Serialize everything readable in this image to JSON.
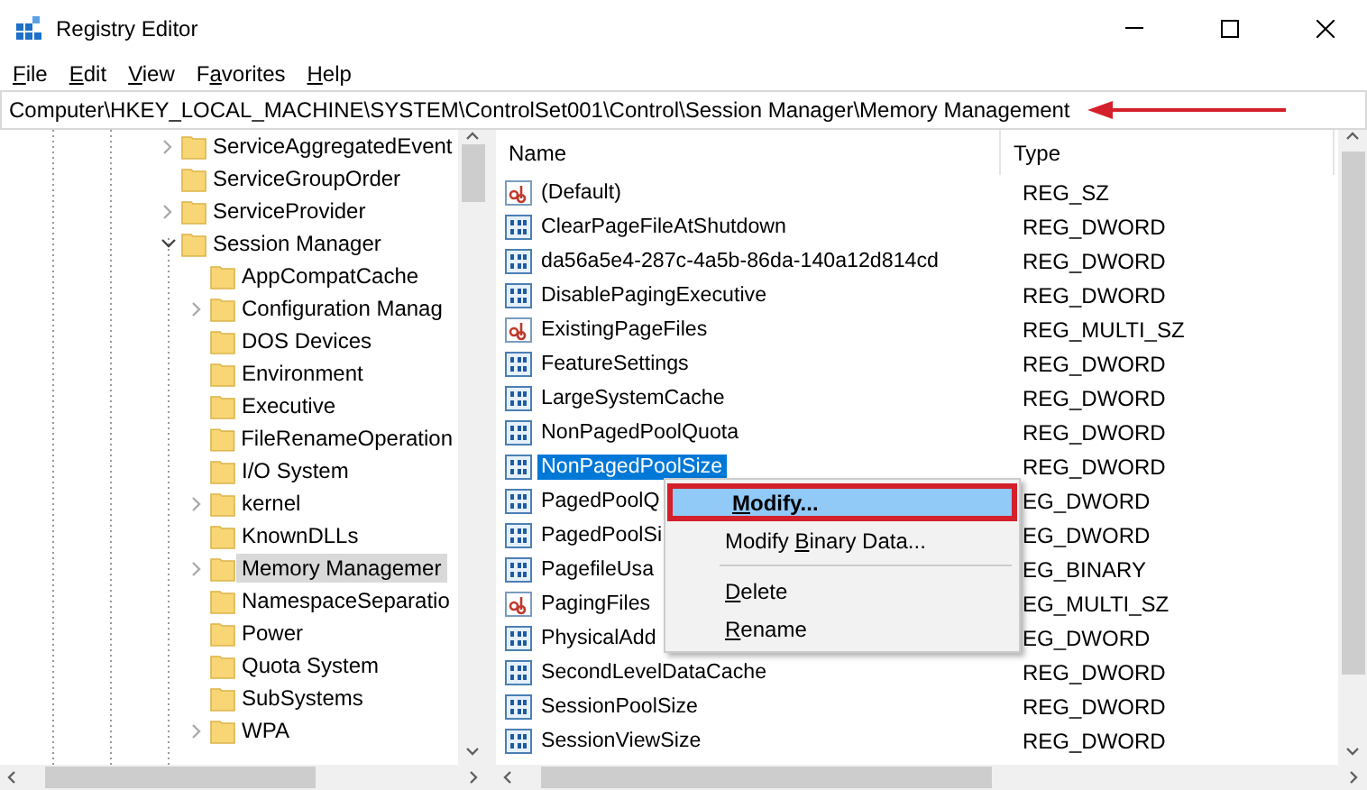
{
  "window": {
    "title": "Registry Editor"
  },
  "menu": [
    {
      "key": "F",
      "after": "ile"
    },
    {
      "key": "E",
      "after": "dit"
    },
    {
      "key": "V",
      "after": "iew"
    },
    {
      "before": "F",
      "key": "a",
      "after": "vorites"
    },
    {
      "key": "H",
      "after": "elp"
    }
  ],
  "address_bar": {
    "path": "Computer\\HKEY_LOCAL_MACHINE\\SYSTEM\\ControlSet001\\Control\\Session Manager\\Memory Management",
    "annotated": true
  },
  "tree": [
    {
      "label": "ServiceAggregatedEvent",
      "has_children": true,
      "expanded": false,
      "selected": false
    },
    {
      "label": "ServiceGroupOrder",
      "has_children": false,
      "selected": false
    },
    {
      "label": "ServiceProvider",
      "has_children": true,
      "expanded": false,
      "selected": false
    },
    {
      "label": "Session Manager",
      "has_children": true,
      "expanded": true,
      "selected": false,
      "children": [
        {
          "label": "AppCompatCache",
          "has_children": false,
          "selected": false
        },
        {
          "label": "Configuration Manag",
          "has_children": true,
          "expanded": false,
          "selected": false
        },
        {
          "label": "DOS Devices",
          "has_children": false,
          "selected": false
        },
        {
          "label": "Environment",
          "has_children": false,
          "selected": false
        },
        {
          "label": "Executive",
          "has_children": false,
          "selected": false
        },
        {
          "label": "FileRenameOperation",
          "has_children": false,
          "selected": false
        },
        {
          "label": "I/O System",
          "has_children": false,
          "selected": false
        },
        {
          "label": "kernel",
          "has_children": true,
          "expanded": false,
          "selected": false
        },
        {
          "label": "KnownDLLs",
          "has_children": false,
          "selected": false
        },
        {
          "label": "Memory Managemer",
          "has_children": true,
          "expanded": false,
          "selected": true
        },
        {
          "label": "NamespaceSeparatio",
          "has_children": false,
          "selected": false
        },
        {
          "label": "Power",
          "has_children": false,
          "selected": false
        },
        {
          "label": "Quota System",
          "has_children": false,
          "selected": false
        },
        {
          "label": "SubSystems",
          "has_children": false,
          "selected": false
        },
        {
          "label": "WPA",
          "has_children": true,
          "expanded": false,
          "selected": false
        }
      ]
    }
  ],
  "table": {
    "columns": [
      "Name",
      "Type"
    ],
    "rows": [
      {
        "kind": "string",
        "name": "(Default)",
        "type": "REG_SZ",
        "selected": false
      },
      {
        "kind": "binary",
        "name": "ClearPageFileAtShutdown",
        "type": "REG_DWORD",
        "selected": false
      },
      {
        "kind": "binary",
        "name": "da56a5e4-287c-4a5b-86da-140a12d814cd",
        "type": "REG_DWORD",
        "selected": false
      },
      {
        "kind": "binary",
        "name": "DisablePagingExecutive",
        "type": "REG_DWORD",
        "selected": false
      },
      {
        "kind": "string",
        "name": "ExistingPageFiles",
        "type": "REG_MULTI_SZ",
        "selected": false
      },
      {
        "kind": "binary",
        "name": "FeatureSettings",
        "type": "REG_DWORD",
        "selected": false
      },
      {
        "kind": "binary",
        "name": "LargeSystemCache",
        "type": "REG_DWORD",
        "selected": false
      },
      {
        "kind": "binary",
        "name": "NonPagedPoolQuota",
        "type": "REG_DWORD",
        "selected": false
      },
      {
        "kind": "binary",
        "name": "NonPagedPoolSize",
        "type": "REG_DWORD",
        "selected": true
      },
      {
        "kind": "binary",
        "name": "PagedPoolQ",
        "type": "EG_DWORD",
        "selected": false
      },
      {
        "kind": "binary",
        "name": "PagedPoolSi",
        "type": "EG_DWORD",
        "selected": false
      },
      {
        "kind": "binary",
        "name": "PagefileUsa",
        "type": "EG_BINARY",
        "selected": false
      },
      {
        "kind": "string",
        "name": "PagingFiles",
        "type": "EG_MULTI_SZ",
        "selected": false
      },
      {
        "kind": "binary",
        "name": "PhysicalAdd",
        "type": "EG_DWORD",
        "selected": false
      },
      {
        "kind": "binary",
        "name": "SecondLevelDataCache",
        "type": "REG_DWORD",
        "selected": false
      },
      {
        "kind": "binary",
        "name": "SessionPoolSize",
        "type": "REG_DWORD",
        "selected": false
      },
      {
        "kind": "binary",
        "name": "SessionViewSize",
        "type": "REG_DWORD",
        "selected": false
      }
    ]
  },
  "context_menu": [
    {
      "kind": "item",
      "key": "M",
      "after": "odify...",
      "bold": true,
      "selected": true,
      "annotated": true
    },
    {
      "kind": "item",
      "before": "Modify ",
      "key": "B",
      "after": "inary Data...",
      "bold": false,
      "selected": false,
      "annotated": false
    },
    {
      "kind": "separator"
    },
    {
      "kind": "item",
      "key": "D",
      "after": "elete",
      "bold": false,
      "selected": false,
      "annotated": false
    },
    {
      "kind": "item",
      "key": "R",
      "after": "ename",
      "bold": false,
      "selected": false,
      "annotated": false
    }
  ]
}
